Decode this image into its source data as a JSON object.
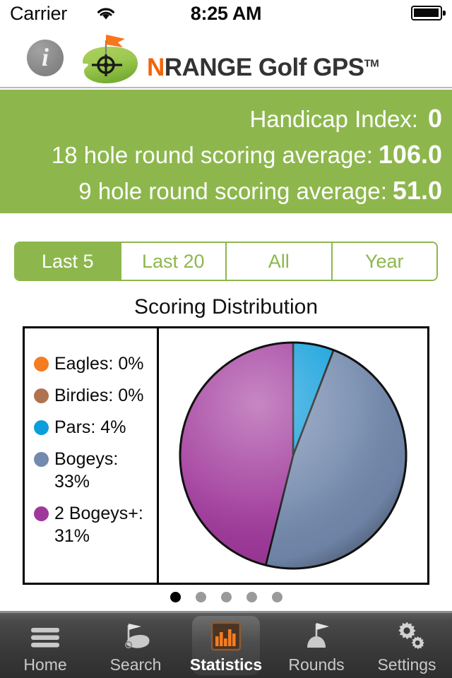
{
  "status_bar": {
    "carrier": "Carrier",
    "time": "8:25 AM",
    "wifi_icon": "wifi-icon",
    "battery_icon": "battery-full-icon"
  },
  "header": {
    "info_button_label": "i",
    "logo_icon": "golf-green-flag-target-icon",
    "brand_first_letter": "N",
    "brand_rest": "RANGE Golf GPS",
    "brand_tm": "TM"
  },
  "banner": {
    "handicap_label": "Handicap Index:",
    "handicap_value": "0",
    "avg18_label": "18 hole round scoring average:",
    "avg18_value": "106.0",
    "avg9_label": "9 hole round scoring average:",
    "avg9_value": "51.0",
    "background_color": "#8DB74C"
  },
  "filter_tabs": {
    "selected": "Last 5",
    "items": [
      {
        "label": "Last 5",
        "active": true
      },
      {
        "label": "Last 20",
        "active": false
      },
      {
        "label": "All",
        "active": false
      },
      {
        "label": "Year",
        "active": false
      }
    ]
  },
  "chart_data": {
    "type": "pie",
    "title": "Scoring Distribution",
    "legend_position": "left",
    "categories": [
      "Eagles",
      "Birdies",
      "Pars",
      "Bogeys",
      "2 Bogeys+"
    ],
    "values": [
      0,
      0,
      4,
      33,
      31
    ],
    "labels": [
      "Eagles: 0%",
      "Birdies: 0%",
      "Pars: 4%",
      "Bogeys: 33%",
      "2 Bogeys+: 31%"
    ],
    "colors": [
      "#F57C1F",
      "#B07350",
      "#0D9DDB",
      "#7389AD",
      "#A0389B"
    ],
    "slices": [
      {
        "name": "Eagles",
        "percent": 0,
        "color": "#F57C1F",
        "start_deg": 0,
        "end_deg": 0
      },
      {
        "name": "Birdies",
        "percent": 0,
        "color": "#B07350",
        "start_deg": 0,
        "end_deg": 0
      },
      {
        "name": "Pars",
        "percent": 4,
        "color": "#0D9DDB",
        "start_deg": 0,
        "end_deg": 21
      },
      {
        "name": "Bogeys",
        "percent": 33,
        "color": "#7389AD",
        "start_deg": 21,
        "end_deg": 194
      },
      {
        "name": "2 Bogeys+",
        "percent": 31,
        "color": "#A0389B",
        "start_deg": 194,
        "end_deg": 360
      }
    ]
  },
  "pagination": {
    "total": 5,
    "active_index": 0
  },
  "tab_bar": {
    "items": [
      {
        "label": "Home",
        "icon": "hamburger-menu-icon",
        "active": false
      },
      {
        "label": "Search",
        "icon": "golf-flag-green-icon",
        "active": false
      },
      {
        "label": "Statistics",
        "icon": "bar-chart-icon",
        "active": true
      },
      {
        "label": "Rounds",
        "icon": "flag-on-mound-icon",
        "active": false
      },
      {
        "label": "Settings",
        "icon": "gears-icon",
        "active": false
      }
    ]
  }
}
